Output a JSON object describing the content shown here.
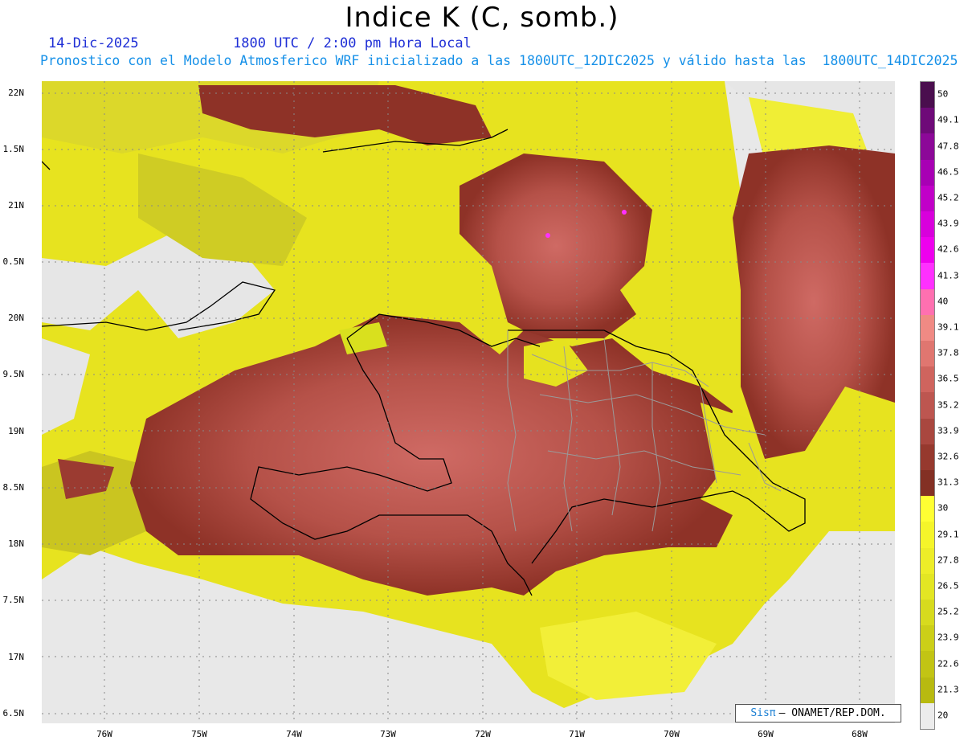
{
  "title": "Indice K (C, somb.)",
  "date": "14-Dic-2025",
  "time": "1800 UTC / 2:00 pm Hora Local",
  "subtitle": "Pronostico con el Modelo Atmosferico WRF inicializado a las 1800UTC_12DIC2025 y válido hasta las  1800UTC_14DIC2025",
  "lat_labels": [
    "22N",
    "1.5N",
    "21N",
    "0.5N",
    "20N",
    "9.5N",
    "19N",
    "8.5N",
    "18N",
    "7.5N",
    "17N",
    "6.5N"
  ],
  "lon_labels": [
    "76W",
    "75W",
    "74W",
    "73W",
    "72W",
    "71W",
    "70W",
    "69W",
    "68W"
  ],
  "colorbar": {
    "labels": [
      "50",
      "49.1",
      "47.8",
      "46.5",
      "45.2",
      "43.9",
      "42.6",
      "41.3",
      "40",
      "39.1",
      "37.8",
      "36.5",
      "35.2",
      "33.9",
      "32.6",
      "31.3",
      "30",
      "29.1",
      "27.8",
      "26.5",
      "25.2",
      "23.9",
      "22.6",
      "21.3",
      "20"
    ],
    "colors": [
      "#4a0e4e",
      "#6e0a78",
      "#8c0898",
      "#a800b4",
      "#c100c8",
      "#d800dc",
      "#ee00ee",
      "#ff30ff",
      "#ff70b0",
      "#f08a84",
      "#e07670",
      "#cf645e",
      "#bd5650",
      "#a9473f",
      "#96392e",
      "#833024",
      "#ffff33",
      "#f5f52a",
      "#eded28",
      "#e3e623",
      "#d7db1e",
      "#cccf18",
      "#c2c414",
      "#b8ba10",
      "#ececec"
    ]
  },
  "credit": {
    "brand": "Sisπ",
    "text": "– ONAMET/REP.DOM."
  }
}
